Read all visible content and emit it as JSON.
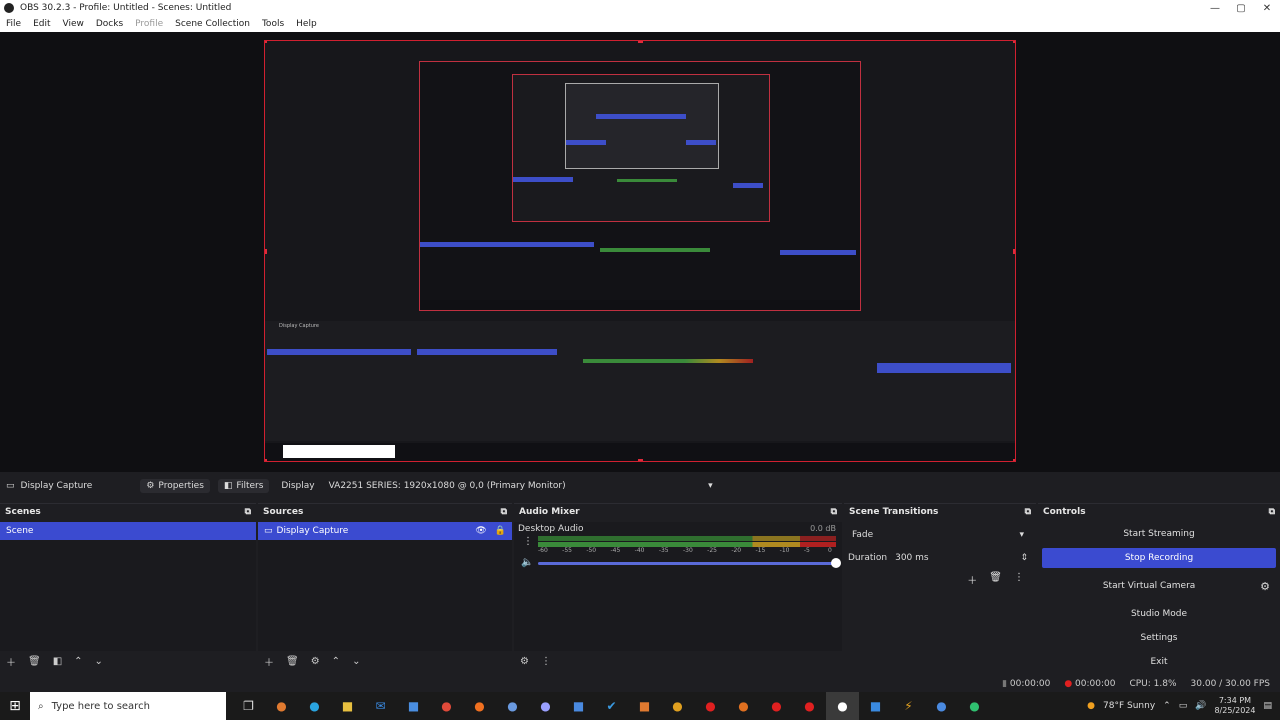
{
  "window": {
    "title": "OBS 30.2.3 - Profile: Untitled - Scenes: Untitled"
  },
  "menu": {
    "file": "File",
    "edit": "Edit",
    "view": "View",
    "docks": "Docks",
    "profile": "Profile",
    "scene_collection": "Scene Collection",
    "tools": "Tools",
    "help": "Help"
  },
  "sourcebar": {
    "source_name": "Display Capture",
    "properties": "Properties",
    "filters": "Filters",
    "display_label": "Display",
    "display_value": "VA2251 SERIES: 1920x1080 @ 0,0 (Primary Monitor)"
  },
  "scenes": {
    "title": "Scenes",
    "items": [
      "Scene"
    ]
  },
  "sources": {
    "title": "Sources",
    "items": [
      "Display Capture"
    ]
  },
  "mixer": {
    "title": "Audio Mixer",
    "channel": "Desktop Audio",
    "level": "0.0 dB",
    "ticks": [
      "-60",
      "-55",
      "-50",
      "-45",
      "-40",
      "-35",
      "-30",
      "-25",
      "-20",
      "-15",
      "-10",
      "-5",
      "0"
    ],
    "volume": 1.0
  },
  "transitions": {
    "title": "Scene Transitions",
    "type": "Fade",
    "duration_label": "Duration",
    "duration_value": "300 ms"
  },
  "controls": {
    "title": "Controls",
    "start_streaming": "Start Streaming",
    "stop_recording": "Stop Recording",
    "start_virtual_camera": "Start Virtual Camera",
    "studio_mode": "Studio Mode",
    "settings": "Settings",
    "exit": "Exit"
  },
  "status": {
    "stream_time": "00:00:00",
    "rec_time": "00:00:00",
    "cpu": "CPU: 1.8%",
    "fps": "30.00 / 30.00 FPS"
  },
  "taskbar": {
    "search_placeholder": "Type here to search",
    "weather": "78°F  Sunny",
    "time": "7:34 PM",
    "date": "8/25/2024"
  }
}
